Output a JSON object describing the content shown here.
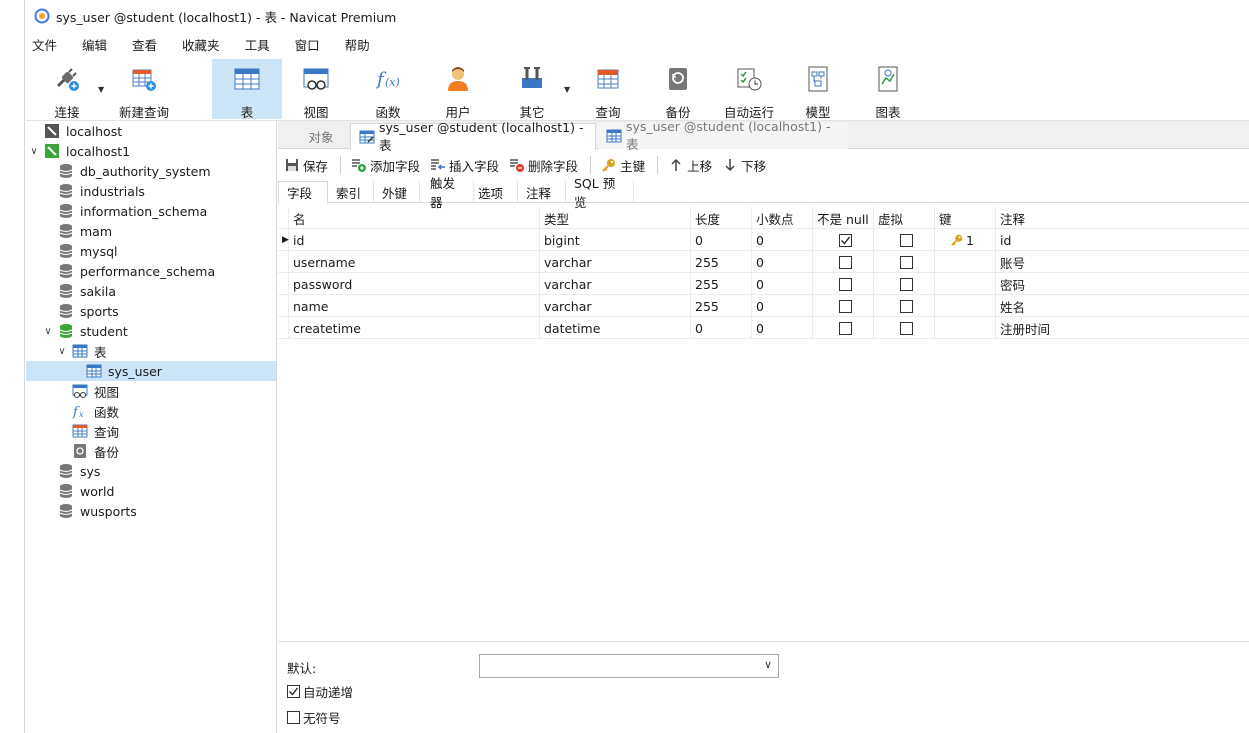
{
  "window": {
    "title": "sys_user @student (localhost1) - 表 - Navicat Premium"
  },
  "menu": [
    "文件",
    "编辑",
    "查看",
    "收藏夹",
    "工具",
    "窗口",
    "帮助"
  ],
  "toolbar": {
    "connect": "连接",
    "new_query": "新建查询",
    "table": "表",
    "view": "视图",
    "function": "函数",
    "user": "用户",
    "other": "其它",
    "query": "查询",
    "backup": "备份",
    "automation": "自动运行",
    "model": "模型",
    "chart": "图表"
  },
  "tree": {
    "localhost": "localhost",
    "localhost1": "localhost1",
    "databases": [
      "db_authority_system",
      "industrials",
      "information_schema",
      "mam",
      "mysql",
      "performance_schema",
      "sakila",
      "sports",
      "student"
    ],
    "student_children": {
      "tables": "表",
      "sys_user": "sys_user",
      "views": "视图",
      "functions": "函数",
      "queries": "查询",
      "backups": "备份"
    },
    "databases_after": [
      "sys",
      "world",
      "wusports"
    ]
  },
  "doc_tabs": {
    "objects": "对象",
    "active": "sys_user @student (localhost1) - 表",
    "inactive": "sys_user @student (localhost1) - 表"
  },
  "actions": {
    "save": "保存",
    "add_field": "添加字段",
    "insert_field": "插入字段",
    "delete_field": "删除字段",
    "primary_key": "主键",
    "move_up": "上移",
    "move_down": "下移"
  },
  "sub_tabs": [
    "字段",
    "索引",
    "外键",
    "触发器",
    "选项",
    "注释",
    "SQL 预览"
  ],
  "grid": {
    "headers": {
      "name": "名",
      "type": "类型",
      "length": "长度",
      "decimals": "小数点",
      "not_null": "不是 null",
      "virtual": "虚拟",
      "key": "键",
      "comment": "注释"
    },
    "rows": [
      {
        "name": "id",
        "type": "bigint",
        "length": "0",
        "decimals": "0",
        "not_null": true,
        "virtual": false,
        "key": "1",
        "comment": "id"
      },
      {
        "name": "username",
        "type": "varchar",
        "length": "255",
        "decimals": "0",
        "not_null": false,
        "virtual": false,
        "key": "",
        "comment": "账号"
      },
      {
        "name": "password",
        "type": "varchar",
        "length": "255",
        "decimals": "0",
        "not_null": false,
        "virtual": false,
        "key": "",
        "comment": "密码"
      },
      {
        "name": "name",
        "type": "varchar",
        "length": "255",
        "decimals": "0",
        "not_null": false,
        "virtual": false,
        "key": "",
        "comment": "姓名"
      },
      {
        "name": "createtime",
        "type": "datetime",
        "length": "0",
        "decimals": "0",
        "not_null": false,
        "virtual": false,
        "key": "",
        "comment": "注册时间"
      }
    ]
  },
  "bottom": {
    "default_label": "默认:",
    "auto_increment_label": "自动递增",
    "auto_increment_checked": true,
    "unsigned_label": "无符号",
    "unsigned_checked": false
  },
  "colors": {
    "selection": "#cce4f7",
    "toolbar_active": "#cde6f7",
    "db_green": "#3ba53b",
    "key_gold": "#d9a21b"
  }
}
